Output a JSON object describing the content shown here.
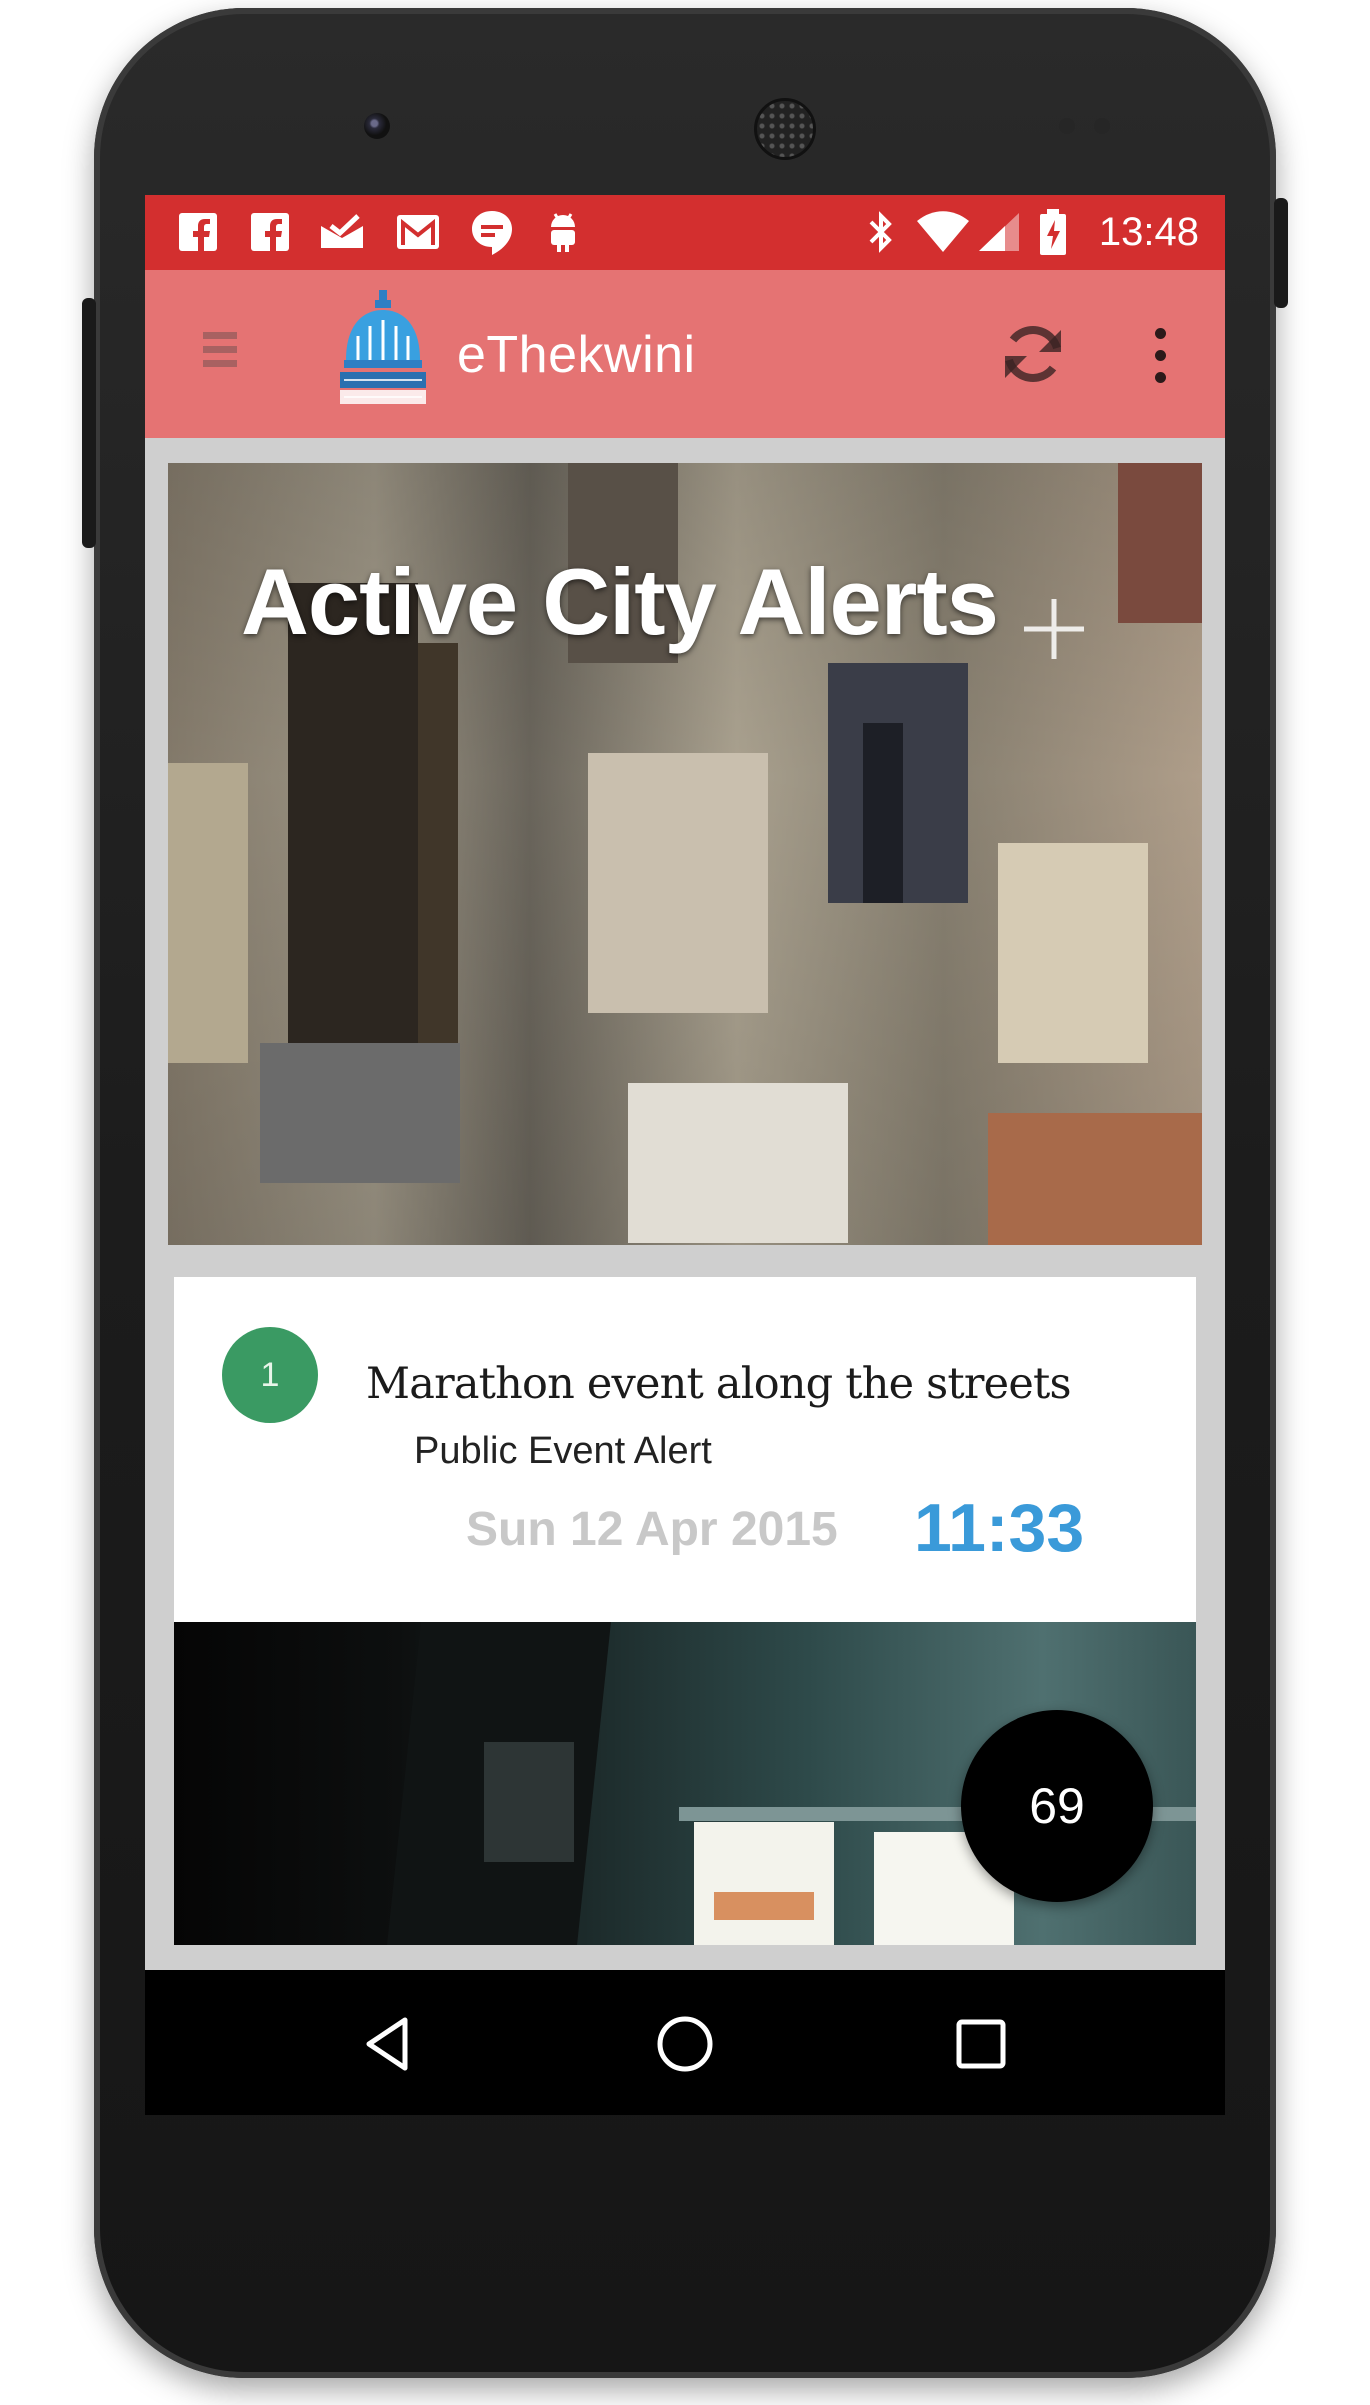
{
  "status_bar": {
    "notification_icons": [
      "facebook-icon",
      "facebook-icon",
      "inbox-icon",
      "gmail-icon",
      "hangouts-icon",
      "android-icon"
    ],
    "system_icons": [
      "bluetooth-icon",
      "wifi-icon",
      "signal-icon",
      "battery-charging-icon"
    ],
    "time": "13:48"
  },
  "app_bar": {
    "title": "eThekwini",
    "logo": "ethekwini-municipality-logo",
    "actions": [
      "refresh-icon",
      "overflow-menu-icon"
    ]
  },
  "hero": {
    "title": "Active City Alerts",
    "action_icon": "add-icon"
  },
  "alert": {
    "index": "1",
    "title": "Marathon event along the streets",
    "type": "Public Event Alert",
    "date": "Sun 12 Apr 2015",
    "time": "11:33"
  },
  "fab": {
    "count": "69"
  },
  "nav_bar": {
    "buttons": [
      "back-icon",
      "home-icon",
      "recents-icon"
    ]
  },
  "colors": {
    "status_bar": "#d32f2f",
    "app_bar": "#e57373",
    "badge": "#3a9a63",
    "time_accent": "#3a9ad9",
    "date": "#c8c8c8"
  }
}
